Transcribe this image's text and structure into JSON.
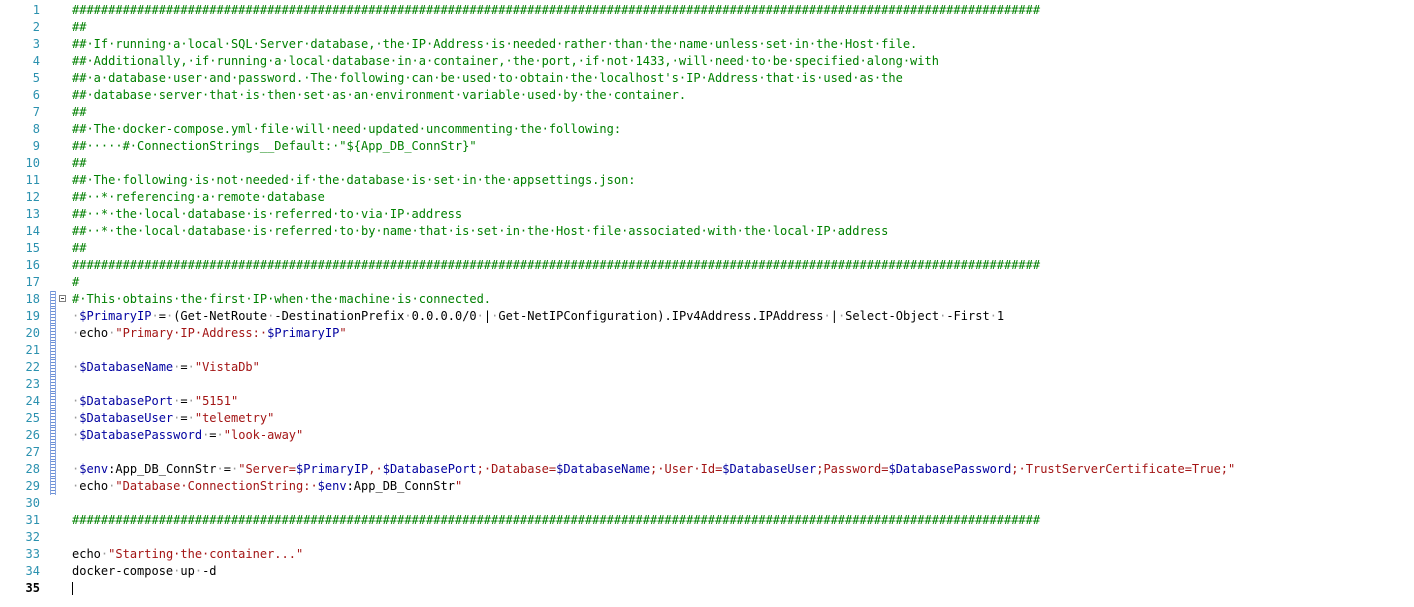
{
  "editor": {
    "language": "PowerShell",
    "current_line": 35,
    "folded_region_start": 18,
    "lines": [
      {
        "n": "1",
        "segs": [
          [
            "c",
            "######################################################################################################################################"
          ]
        ]
      },
      {
        "n": "2",
        "segs": [
          [
            "c",
            "##"
          ]
        ]
      },
      {
        "n": "3",
        "segs": [
          [
            "c",
            "##·If·running·a·local·SQL·Server·database,·the·IP·Address·is·needed·rather·than·the·name·unless·set·in·the·Host·file."
          ]
        ]
      },
      {
        "n": "4",
        "segs": [
          [
            "c",
            "##·Additionally,·if·running·a·local·database·in·a·container,·the·port,·if·not·1433,·will·need·to·be·specified·along·with"
          ]
        ]
      },
      {
        "n": "5",
        "segs": [
          [
            "c",
            "##·a·database·user·and·password.·The·following·can·be·used·to·obtain·the·localhost's·IP·Address·that·is·used·as·the"
          ]
        ]
      },
      {
        "n": "6",
        "segs": [
          [
            "c",
            "##·database·server·that·is·then·set·as·an·environment·variable·used·by·the·container."
          ]
        ]
      },
      {
        "n": "7",
        "segs": [
          [
            "c",
            "##"
          ]
        ]
      },
      {
        "n": "8",
        "segs": [
          [
            "c",
            "##·The·docker-compose.yml·file·will·need·updated·uncommenting·the·following:"
          ]
        ]
      },
      {
        "n": "9",
        "segs": [
          [
            "c",
            "##·····#·ConnectionStrings__Default:·\"${App_DB_ConnStr}\""
          ]
        ]
      },
      {
        "n": "10",
        "segs": [
          [
            "c",
            "##"
          ]
        ]
      },
      {
        "n": "11",
        "segs": [
          [
            "c",
            "##·The·following·is·not·needed·if·the·database·is·set·in·the·appsettings.json:"
          ]
        ]
      },
      {
        "n": "12",
        "segs": [
          [
            "c",
            "##··*·referencing·a·remote·database"
          ]
        ]
      },
      {
        "n": "13",
        "segs": [
          [
            "c",
            "##··*·the·local·database·is·referred·to·via·IP·address"
          ]
        ]
      },
      {
        "n": "14",
        "segs": [
          [
            "c",
            "##··*·the·local·database·is·referred·to·by·name·that·is·set·in·the·Host·file·associated·with·the·local·IP·address"
          ]
        ]
      },
      {
        "n": "15",
        "segs": [
          [
            "c",
            "##"
          ]
        ]
      },
      {
        "n": "16",
        "segs": [
          [
            "c",
            "######################################################################################################################################"
          ]
        ]
      },
      {
        "n": "17",
        "segs": [
          [
            "c",
            "#"
          ]
        ]
      },
      {
        "n": "18",
        "segs": [
          [
            "c",
            "#·This·obtains·the·first·IP·when·the·machine·is·connected."
          ]
        ]
      },
      {
        "n": "19",
        "segs": [
          [
            "d",
            "·"
          ],
          [
            "v",
            "$PrimaryIP"
          ],
          [
            "d",
            "·"
          ],
          [
            "p",
            "="
          ],
          [
            "d",
            "·"
          ],
          [
            "p",
            "(Get-NetRoute"
          ],
          [
            "d",
            "·"
          ],
          [
            "p",
            "-DestinationPrefix"
          ],
          [
            "d",
            "·"
          ],
          [
            "p",
            "0.0.0.0/0"
          ],
          [
            "d",
            "·"
          ],
          [
            "p",
            "|"
          ],
          [
            "d",
            "·"
          ],
          [
            "p",
            "Get-NetIPConfiguration).IPv4Address.IPAddress"
          ],
          [
            "d",
            "·"
          ],
          [
            "p",
            "|"
          ],
          [
            "d",
            "·"
          ],
          [
            "p",
            "Select-Object"
          ],
          [
            "d",
            "·"
          ],
          [
            "p",
            "-First"
          ],
          [
            "d",
            "·"
          ],
          [
            "p",
            "1"
          ]
        ]
      },
      {
        "n": "20",
        "segs": [
          [
            "d",
            "·"
          ],
          [
            "p",
            "echo"
          ],
          [
            "d",
            "·"
          ],
          [
            "s",
            "\"Primary·IP·Address:·"
          ],
          [
            "v",
            "$PrimaryIP"
          ],
          [
            "s",
            "\""
          ]
        ]
      },
      {
        "n": "21",
        "segs": []
      },
      {
        "n": "22",
        "segs": [
          [
            "d",
            "·"
          ],
          [
            "v",
            "$DatabaseName"
          ],
          [
            "d",
            "·"
          ],
          [
            "p",
            "="
          ],
          [
            "d",
            "·"
          ],
          [
            "s",
            "\"VistaDb\""
          ]
        ]
      },
      {
        "n": "23",
        "segs": []
      },
      {
        "n": "24",
        "segs": [
          [
            "d",
            "·"
          ],
          [
            "v",
            "$DatabasePort"
          ],
          [
            "d",
            "·"
          ],
          [
            "p",
            "="
          ],
          [
            "d",
            "·"
          ],
          [
            "s",
            "\"5151\""
          ]
        ]
      },
      {
        "n": "25",
        "segs": [
          [
            "d",
            "·"
          ],
          [
            "v",
            "$DatabaseUser"
          ],
          [
            "d",
            "·"
          ],
          [
            "p",
            "="
          ],
          [
            "d",
            "·"
          ],
          [
            "s",
            "\"telemetry\""
          ]
        ]
      },
      {
        "n": "26",
        "segs": [
          [
            "d",
            "·"
          ],
          [
            "v",
            "$DatabasePassword"
          ],
          [
            "d",
            "·"
          ],
          [
            "p",
            "="
          ],
          [
            "d",
            "·"
          ],
          [
            "s",
            "\"look-away\""
          ]
        ]
      },
      {
        "n": "27",
        "segs": []
      },
      {
        "n": "28",
        "segs": [
          [
            "d",
            "·"
          ],
          [
            "v",
            "$env"
          ],
          [
            "p",
            ":App_DB_ConnStr"
          ],
          [
            "d",
            "·"
          ],
          [
            "p",
            "="
          ],
          [
            "d",
            "·"
          ],
          [
            "s",
            "\"Server="
          ],
          [
            "v",
            "$PrimaryIP"
          ],
          [
            "s",
            ",·"
          ],
          [
            "v",
            "$DatabasePort"
          ],
          [
            "s",
            ";·Database="
          ],
          [
            "v",
            "$DatabaseName"
          ],
          [
            "s",
            ";·User·Id="
          ],
          [
            "v",
            "$DatabaseUser"
          ],
          [
            "s",
            ";Password="
          ],
          [
            "v",
            "$DatabasePassword"
          ],
          [
            "s",
            ";·TrustServerCertificate=True;\""
          ]
        ]
      },
      {
        "n": "29",
        "segs": [
          [
            "d",
            "·"
          ],
          [
            "p",
            "echo"
          ],
          [
            "d",
            "·"
          ],
          [
            "s",
            "\"Database·ConnectionString:·"
          ],
          [
            "v",
            "$env"
          ],
          [
            "p",
            ":App_DB_ConnStr"
          ],
          [
            "s",
            "\""
          ]
        ]
      },
      {
        "n": "30",
        "segs": []
      },
      {
        "n": "31",
        "segs": [
          [
            "c",
            "######################################################################################################################################"
          ]
        ]
      },
      {
        "n": "32",
        "segs": []
      },
      {
        "n": "33",
        "segs": [
          [
            "p",
            "echo"
          ],
          [
            "d",
            "·"
          ],
          [
            "s",
            "\"Starting·the·container...\""
          ]
        ]
      },
      {
        "n": "34",
        "segs": [
          [
            "p",
            "docker-compose"
          ],
          [
            "d",
            "·"
          ],
          [
            "p",
            "up"
          ],
          [
            "d",
            "·"
          ],
          [
            "p",
            "-d"
          ]
        ]
      },
      {
        "n": "35",
        "segs": []
      }
    ]
  }
}
